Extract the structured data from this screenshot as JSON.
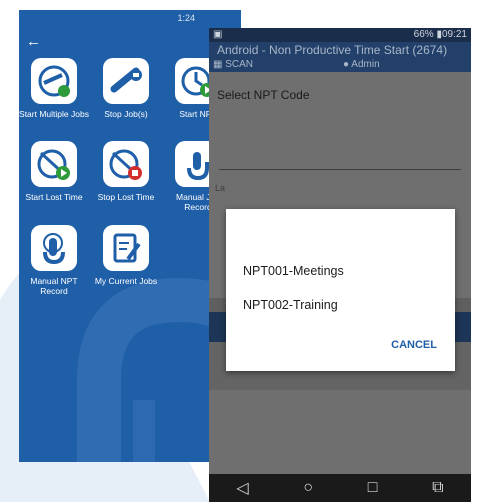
{
  "left_app": {
    "status_time": "1:24",
    "tiles": [
      {
        "label": "Start Multiple Jobs",
        "icon": "start-multiple-jobs-icon"
      },
      {
        "label": "Stop Job(s)",
        "icon": "stop-jobs-icon"
      },
      {
        "label": "Start NPT",
        "icon": "start-npt-icon"
      },
      {
        "label": "Start Lost Time",
        "icon": "start-lost-time-icon"
      },
      {
        "label": "Stop Lost Time",
        "icon": "stop-lost-time-icon"
      },
      {
        "label": "Manual Job Record",
        "icon": "manual-job-record-icon"
      },
      {
        "label": "Manual NPT Record",
        "icon": "manual-npt-record-icon"
      },
      {
        "label": "My Current Jobs",
        "icon": "my-current-jobs-icon"
      }
    ]
  },
  "right_app": {
    "status_left": "▣",
    "status_right": "66% ▮09:21",
    "title": "Android - Non Productive Time Start (2674)",
    "scan_label": "SCAN",
    "user_label": "Admin",
    "field_label": "Select NPT Code",
    "dim_text": "La",
    "dialog": {
      "options": [
        "NPT001-Meetings",
        "NPT002-Training"
      ],
      "cancel_label": "CANCEL"
    }
  },
  "colors": {
    "brand_blue": "#1f5fa8",
    "header_dark": "#22406a",
    "dialog_bg": "#ffffff"
  }
}
